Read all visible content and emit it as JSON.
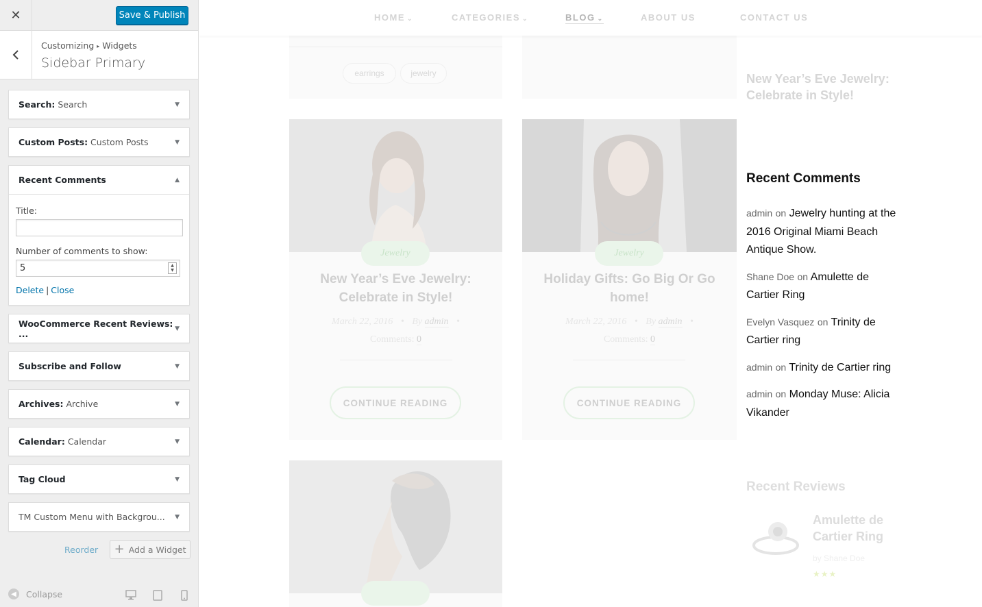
{
  "panel": {
    "close_icon": "close-icon",
    "publish_label": "Save & Publish",
    "breadcrumb": {
      "root": "Customizing",
      "current": "Widgets"
    },
    "section_title": "Sidebar Primary",
    "widgets": [
      {
        "title": "Search",
        "subtitle": "Search"
      },
      {
        "title": "Custom Posts",
        "subtitle": "Custom Posts"
      },
      {
        "title": "Recent Comments",
        "subtitle": ""
      },
      {
        "title": "WooCommerce Recent Reviews: ...",
        "subtitle": ""
      },
      {
        "title": "Subscribe and Follow",
        "subtitle": ""
      },
      {
        "title": "Archives",
        "subtitle": "Archive"
      },
      {
        "title": "Calendar",
        "subtitle": "Calendar"
      },
      {
        "title": "Tag Cloud",
        "subtitle": ""
      },
      {
        "title": "TM Custom Menu with Backgrou...",
        "subtitle": ""
      }
    ],
    "recent_comments_form": {
      "title_label": "Title:",
      "title_value": "",
      "number_label": "Number of comments to show:",
      "number_value": "5",
      "delete_label": "Delete",
      "separator": "|",
      "close_label": "Close"
    },
    "reorder_label": "Reorder",
    "add_widget_label": "Add a Widget",
    "collapse_label": "Collapse"
  },
  "preview": {
    "nav": [
      "HOME",
      "CATEGORIES",
      "BLOG",
      "ABOUT US",
      "CONTACT US"
    ],
    "top_tags": [
      "earrings",
      "jewelry"
    ],
    "posts": [
      {
        "category": "Jewelry",
        "title": "New Year’s Eve Jewelry: Celebrate in Style!",
        "date": "March 22, 2016",
        "by": "By",
        "author": "admin",
        "comments_label": "Comments:",
        "comments": "0",
        "read_more": "CONTINUE READING"
      },
      {
        "category": "Jewelry",
        "title": "Holiday Gifts: Go Big Or Go home!",
        "date": "March 22, 2016",
        "by": "By",
        "author": "admin",
        "comments_label": "Comments:",
        "comments": "0",
        "read_more": "CONTINUE READING"
      }
    ],
    "sidebar_top_post": "New Year’s Eve Jewelry: Celebrate in Style!",
    "recent_comments": {
      "heading": "Recent Comments",
      "on": "on",
      "items": [
        {
          "author": "admin",
          "post": "Jewelry hunting at the 2016 Original Miami Beach Antique Show."
        },
        {
          "author": "Shane Doe",
          "post": "Amulette de Cartier Ring"
        },
        {
          "author": "Evelyn Vasquez",
          "post": "Trinity de Cartier ring"
        },
        {
          "author": "admin",
          "post": "Trinity de Cartier ring"
        },
        {
          "author": "admin",
          "post": "Monday Muse: Alicia Vikander"
        }
      ]
    },
    "recent_reviews": {
      "heading": "Recent Reviews",
      "item_title": "Amulette de Cartier Ring",
      "item_by": "by Shane Doe",
      "stars": 3
    }
  },
  "colors": {
    "primary_button": "#0085ba",
    "link": "#0073aa",
    "badge_green": "#eaf5ea"
  }
}
